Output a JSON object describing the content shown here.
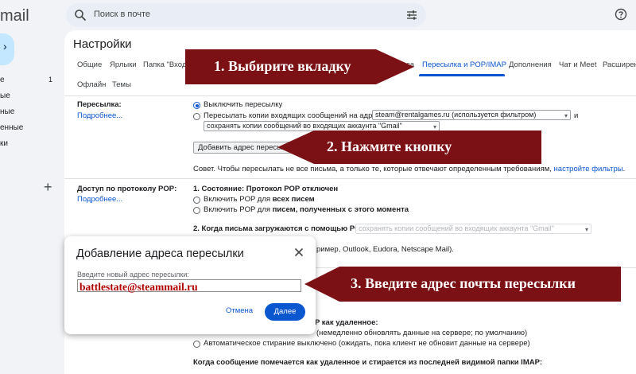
{
  "app": {
    "brand": "mail"
  },
  "sidebar": {
    "items": [
      {
        "label": "е",
        "count": "1"
      },
      {
        "label": "ые",
        "count": ""
      },
      {
        "label": "ные",
        "count": ""
      },
      {
        "label": "енные",
        "count": ""
      },
      {
        "label": "ки",
        "count": ""
      }
    ]
  },
  "search": {
    "placeholder": "Поиск в почте"
  },
  "page": {
    "title": "Настройки"
  },
  "tabs": [
    {
      "label": "Общие"
    },
    {
      "label": "Ярлыки"
    },
    {
      "label": "Папка \"Вход"
    },
    {
      "label": "са"
    },
    {
      "label": "Пересылка и POP/IMAP",
      "active": true
    },
    {
      "label": "Дополнения"
    },
    {
      "label": "Чат и Meet"
    },
    {
      "label": "Расширен"
    },
    {
      "label": "Офлайн"
    },
    {
      "label": "Темы"
    }
  ],
  "forwarding": {
    "label": "Пересылка:",
    "more_link": "Подробнее...",
    "opt_disable": "Выключить пересылку",
    "opt_forward": "Пересылать копии входящих сообщений на адрес",
    "forward_address": "steam@rentalgames.ru (используется фильтром)",
    "and_text": "и",
    "keep_copy": "сохранять копии сообщений во входящих аккаунта \"Gmail\"",
    "add_button": "Добавить адрес пересылки",
    "tip_text": "Совет. Чтобы пересылать не все письма, а только те, которые отвечают определенным требованиям,",
    "tip_link": "настройте фильтры",
    "tip_end": "."
  },
  "pop": {
    "label": "Доступ по протоколу POP:",
    "more_link": "Подробнее...",
    "status": "1. Состояние: Протокол POP отключен",
    "opt_all_prefix": "Включить POP для ",
    "opt_all_bold": "всех писем",
    "opt_new_prefix": "Включить POP для ",
    "opt_new_bold": "писем, полученных с этого момента",
    "step2": "2. Когда письма загружаются с помощью POP",
    "step2_select": "сохранять копии сообщений во входящих аккаунта \"Gmail\"",
    "step3_tail": "ример, Outlook, Eudora, Netscape Mail)."
  },
  "imap": {
    "deleted_tail": "P как удаленное:",
    "deleted_opt1": "(немедленно обновлять данные на сервере; по умолчанию)",
    "deleted_opt2": "Автоматическое стирание выключено (ожидать, пока клиент не обновит данные на сервере)",
    "expunge": "Когда сообщение помечается как удаленное и стирается из последней видимой папки IMAP:"
  },
  "dialog": {
    "title": "Добавление адреса пересылки",
    "label": "Введите новый адрес пересылки:",
    "value": "battlestate@steammail.ru",
    "cancel": "Отмена",
    "next": "Далее"
  },
  "annotations": {
    "step1": "1.  Выбирите вкладку",
    "step2": "2.  Нажмите кнопку",
    "step3": "3.  Введите адрес почты пересылки",
    "color": "#7b1114"
  }
}
